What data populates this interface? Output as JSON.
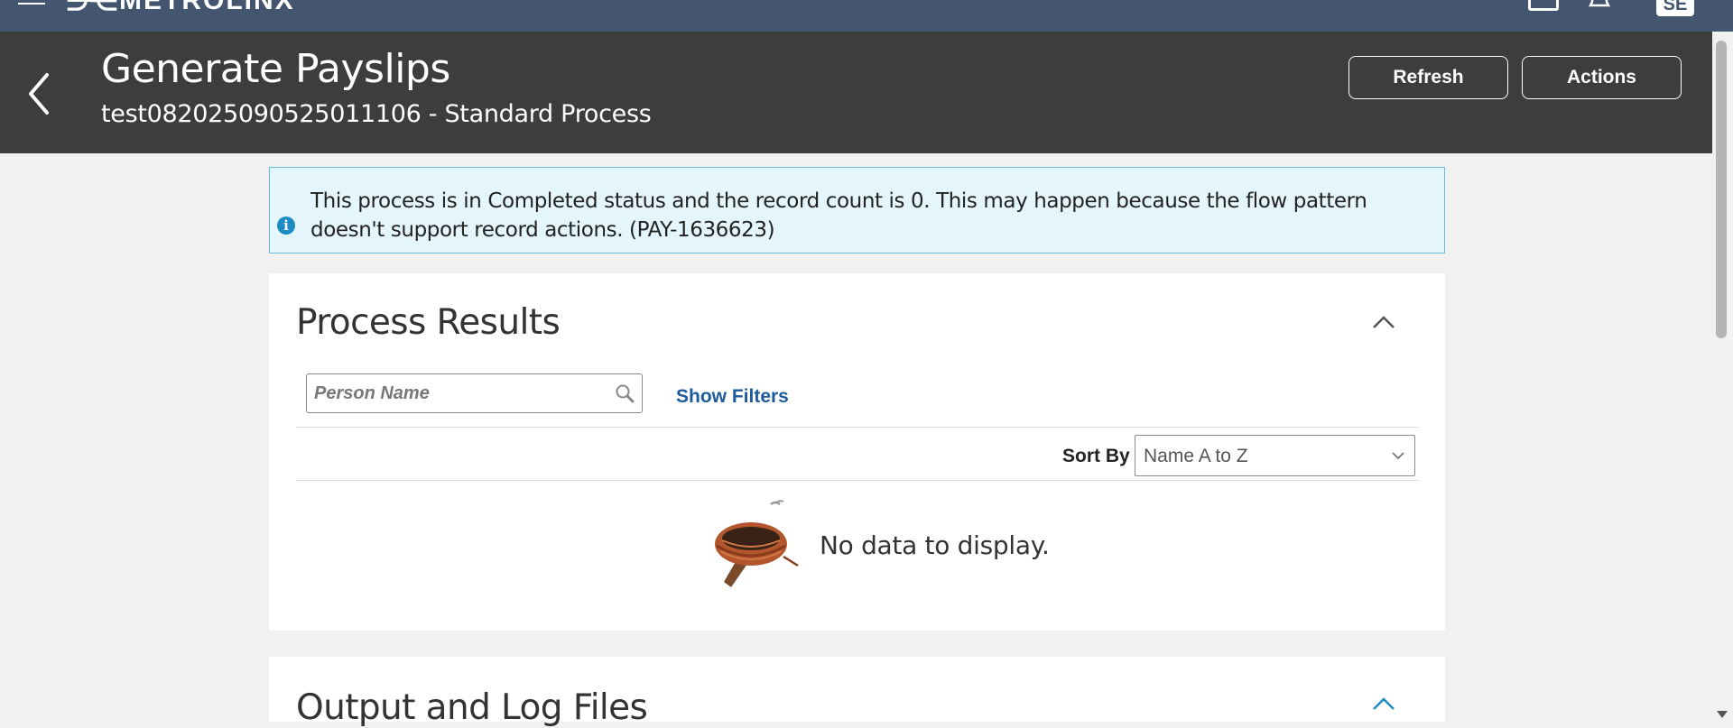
{
  "topbar": {
    "logo_text": "METROLINX",
    "avatar_initials": "SE"
  },
  "header": {
    "title": "Generate Payslips",
    "subtitle": "test082025090525011106 - Standard Process",
    "refresh_label": "Refresh",
    "actions_label": "Actions"
  },
  "banner": {
    "message": "This process is in Completed status and the record count is 0. This may happen because the flow pattern doesn't support record actions. (PAY-1636623)"
  },
  "results": {
    "title": "Process Results",
    "search_placeholder": "Person Name",
    "show_filters_label": "Show Filters",
    "sort_label": "Sort By",
    "sort_value": "Name A to Z",
    "empty_message": "No data to display."
  },
  "output": {
    "title": "Output and Log Files"
  },
  "colors": {
    "topbar": "#44566f",
    "header": "#3d3d3d",
    "link": "#1d5a9e",
    "info_bg": "#e4f5fb",
    "info_border": "#67bdd9"
  }
}
